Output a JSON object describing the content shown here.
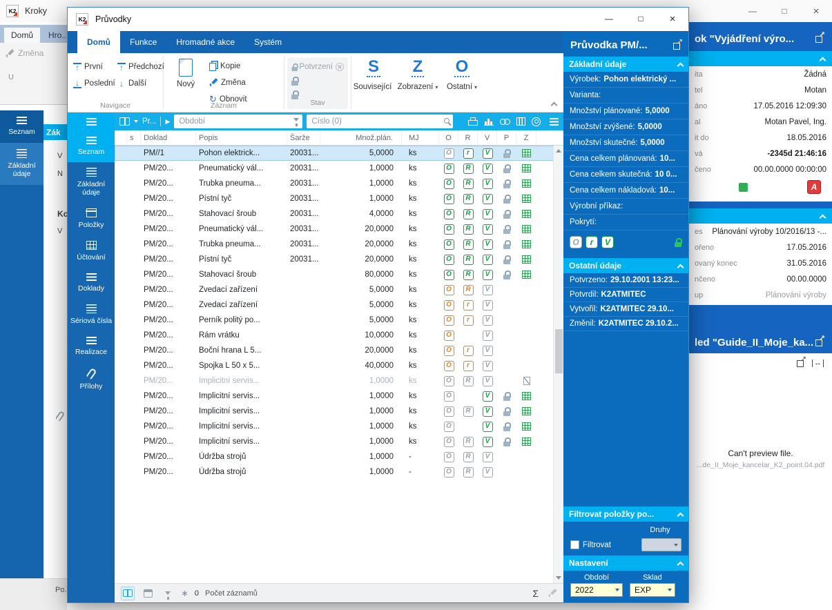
{
  "app": {
    "title": "Kroky",
    "logo": "K2",
    "window_controls": {
      "minimize": "—",
      "maximize": "□",
      "close": "×"
    }
  },
  "bg_left": {
    "tabs": [
      {
        "label": "Domů",
        "cls": "active"
      },
      {
        "label": "Hro...",
        "cls": ""
      }
    ],
    "change_label": "Změna",
    "fragment_u": "U",
    "sidebar": [
      {
        "label": "Seznam",
        "cls": "drk",
        "icon": "icon-lines"
      },
      {
        "label": "Základní údaje",
        "cls": "lit",
        "icon": "icon-lines2"
      }
    ],
    "strip": {
      "header": "Zák",
      "f1": "V",
      "f2": "N",
      "f3": "Ko",
      "f4": "V",
      "bottom": "Po..."
    }
  },
  "bg_right": {
    "panel1": {
      "title": "ok \"Vyjádření výro...",
      "rows": [
        {
          "label": "ita",
          "value": "Žádná",
          "vcls": ""
        },
        {
          "label": "tel",
          "value": "Motan",
          "vcls": ""
        },
        {
          "label": "áno",
          "value": "17.05.2016 12:09:30",
          "vcls": ""
        },
        {
          "label": "al",
          "value": "Motan Pavel, Ing.",
          "vcls": ""
        },
        {
          "label": "it do",
          "value": "18.05.2016",
          "vcls": ""
        },
        {
          "label": "vá",
          "value": "-2345d 21:46:16",
          "vcls": "bold"
        },
        {
          "label": "čeno",
          "value": "00.00.0000 00:00:00",
          "vcls": ""
        }
      ]
    },
    "panel2": {
      "rows": [
        {
          "label": "es",
          "value": "Plánování výroby 10/2016/13 -...",
          "vcls": ""
        },
        {
          "label": "ořeno",
          "value": "17.05.2016",
          "vcls": ""
        },
        {
          "label": "ovaný konec",
          "value": "31.05.2016",
          "vcls": ""
        },
        {
          "label": "nčeno",
          "value": "00.00.0000",
          "vcls": ""
        },
        {
          "label": "up",
          "value": "Plánování výroby",
          "vcls": "muted"
        }
      ]
    },
    "panel3": {
      "title": "led \"Guide_II_Moje_ka...",
      "error": "Can't preview file.",
      "file": "...de_II_Moje_kancelar_K2_point.04.pdf"
    }
  },
  "dialog": {
    "title": "Průvodky",
    "ribbon": {
      "tabs": [
        {
          "label": "Domů",
          "cls": "active"
        },
        {
          "label": "Funkce",
          "cls": ""
        },
        {
          "label": "Hromadné akce",
          "cls": ""
        },
        {
          "label": "Systém",
          "cls": ""
        }
      ],
      "navigace": {
        "first": "První",
        "last": "Poslední",
        "prev": "Předchozí",
        "next": "Další",
        "group": "Navigace"
      },
      "zaznam": {
        "new": "Nový",
        "copy": "Kopie",
        "change": "Změna",
        "refresh": "Obnovit",
        "group": "Záznam"
      },
      "stav": {
        "confirm": "Potvrzení",
        "group": "Stav"
      },
      "big": [
        {
          "letter": "S",
          "label": "Související",
          "arrow": ""
        },
        {
          "letter": "Z",
          "label": "Zobrazení",
          "arrow": "▾"
        },
        {
          "letter": "O",
          "label": "Ostatní",
          "arrow": "▾"
        }
      ]
    },
    "nav": [
      {
        "label": "Seznam",
        "icon": "icon-lines",
        "cls": "active"
      },
      {
        "label": "Základní údaje",
        "icon": "icon-lines2",
        "cls": ""
      },
      {
        "label": "Položky",
        "icon": "icon-boxp",
        "cls": ""
      },
      {
        "label": "Účtování",
        "icon": "icon-gridp",
        "cls": ""
      },
      {
        "label": "Doklady",
        "icon": "icon-lines",
        "cls": ""
      },
      {
        "label": "Sériová čísla",
        "icon": "icon-lines2",
        "cls": ""
      },
      {
        "label": "Realizace",
        "icon": "icon-lines",
        "cls": ""
      },
      {
        "label": "Přílohy",
        "icon": "icon-clip",
        "cls": ""
      }
    ],
    "toolbar": {
      "view": "Pr...",
      "period_placeholder": "Období",
      "number_placeholder": "Číslo (0)"
    },
    "table": {
      "headers": [
        "s",
        "Doklad",
        "Popis",
        "Šarže",
        "Množ.plán.",
        "MJ",
        "O",
        "R",
        "V",
        "P",
        "Z"
      ],
      "rows": [
        {
          "cls": "sel",
          "doklad": "PM//1",
          "popis": "Pohon elektrick...",
          "sarze": "20031...",
          "qty": "5,0000",
          "mj": "ks",
          "o_t": "O",
          "o_c": "gy",
          "r_t": "r",
          "r_c": "g",
          "v_t": "V",
          "v_c": "g",
          "p": "on",
          "z": "gridic"
        },
        {
          "cls": "",
          "doklad": "PM/20...",
          "popis": "Pneumatický vál...",
          "sarze": "20031...",
          "qty": "1,0000",
          "mj": "ks",
          "o_t": "O",
          "o_c": "g",
          "r_t": "R",
          "r_c": "g",
          "v_t": "V",
          "v_c": "g",
          "p": "on",
          "z": "gridic"
        },
        {
          "cls": "",
          "doklad": "PM/20...",
          "popis": "Trubka pneuma...",
          "sarze": "20031...",
          "qty": "1,0000",
          "mj": "ks",
          "o_t": "O",
          "o_c": "g",
          "r_t": "R",
          "r_c": "g",
          "v_t": "V",
          "v_c": "g",
          "p": "on",
          "z": "gridic"
        },
        {
          "cls": "",
          "doklad": "PM/20...",
          "popis": "Pístní tyč",
          "sarze": "20031...",
          "qty": "1,0000",
          "mj": "ks",
          "o_t": "O",
          "o_c": "g",
          "r_t": "R",
          "r_c": "g",
          "v_t": "V",
          "v_c": "g",
          "p": "on",
          "z": "gridic"
        },
        {
          "cls": "",
          "doklad": "PM/20...",
          "popis": "Stahovací šroub",
          "sarze": "20031...",
          "qty": "4,0000",
          "mj": "ks",
          "o_t": "O",
          "o_c": "g",
          "r_t": "R",
          "r_c": "g",
          "v_t": "V",
          "v_c": "g",
          "p": "on",
          "z": "gridic"
        },
        {
          "cls": "",
          "doklad": "PM/20...",
          "popis": "Pneumatický vál...",
          "sarze": "20031...",
          "qty": "20,0000",
          "mj": "ks",
          "o_t": "O",
          "o_c": "g",
          "r_t": "R",
          "r_c": "g",
          "v_t": "V",
          "v_c": "g",
          "p": "on",
          "z": "gridic"
        },
        {
          "cls": "",
          "doklad": "PM/20...",
          "popis": "Trubka pneuma...",
          "sarze": "20031...",
          "qty": "20,0000",
          "mj": "ks",
          "o_t": "O",
          "o_c": "g",
          "r_t": "R",
          "r_c": "g",
          "v_t": "V",
          "v_c": "g",
          "p": "on",
          "z": "gridic"
        },
        {
          "cls": "",
          "doklad": "PM/20...",
          "popis": "Pístní tyč",
          "sarze": "20031...",
          "qty": "20,0000",
          "mj": "ks",
          "o_t": "O",
          "o_c": "g",
          "r_t": "R",
          "r_c": "g",
          "v_t": "V",
          "v_c": "g",
          "p": "on",
          "z": "gridic"
        },
        {
          "cls": "",
          "doklad": "PM/20...",
          "popis": "Stahovací šroub",
          "sarze": "",
          "qty": "80,0000",
          "mj": "ks",
          "o_t": "O",
          "o_c": "g",
          "r_t": "R",
          "r_c": "g",
          "v_t": "V",
          "v_c": "g",
          "p": "on",
          "z": "gridic"
        },
        {
          "cls": "",
          "doklad": "PM/20...",
          "popis": "Zvedací zařízení",
          "sarze": "",
          "qty": "5,0000",
          "mj": "ks",
          "o_t": "O",
          "o_c": "og",
          "r_t": "R",
          "r_c": "og",
          "v_t": "V",
          "v_c": "gy",
          "p": "",
          "z": ""
        },
        {
          "cls": "",
          "doklad": "PM/20...",
          "popis": "Zvedací zařízení",
          "sarze": "",
          "qty": "5,0000",
          "mj": "ks",
          "o_t": "O",
          "o_c": "og",
          "r_t": "r",
          "r_c": "og",
          "v_t": "V",
          "v_c": "gy",
          "p": "",
          "z": ""
        },
        {
          "cls": "",
          "doklad": "PM/20...",
          "popis": "Perník politý po...",
          "sarze": "",
          "qty": "5,0000",
          "mj": "ks",
          "o_t": "O",
          "o_c": "og",
          "r_t": "r",
          "r_c": "og",
          "v_t": "V",
          "v_c": "gy",
          "p": "",
          "z": ""
        },
        {
          "cls": "",
          "doklad": "PM/20...",
          "popis": "Rám vrátku",
          "sarze": "",
          "qty": "10,0000",
          "mj": "ks",
          "o_t": "O",
          "o_c": "og",
          "r_t": "",
          "r_c": "",
          "v_t": "V",
          "v_c": "gy",
          "p": "",
          "z": ""
        },
        {
          "cls": "",
          "doklad": "PM/20...",
          "popis": "Boční hrana L 5...",
          "sarze": "",
          "qty": "20,0000",
          "mj": "ks",
          "o_t": "O",
          "o_c": "og",
          "r_t": "r",
          "r_c": "og",
          "v_t": "V",
          "v_c": "gy",
          "p": "",
          "z": ""
        },
        {
          "cls": "",
          "doklad": "PM/20...",
          "popis": "Spojka L 50 x 5...",
          "sarze": "",
          "qty": "40,0000",
          "mj": "ks",
          "o_t": "O",
          "o_c": "og",
          "r_t": "r",
          "r_c": "og",
          "v_t": "V",
          "v_c": "gy",
          "p": "",
          "z": ""
        },
        {
          "cls": "dim",
          "doklad": "PM/20...",
          "popis": "Implicitní servis...",
          "sarze": "",
          "qty": "1,0000",
          "mj": "ks",
          "o_t": "O",
          "o_c": "gy",
          "r_t": "R",
          "r_c": "gy",
          "v_t": "V",
          "v_c": "gy",
          "p": "",
          "z": "docx"
        },
        {
          "cls": "",
          "doklad": "PM/20...",
          "popis": "Implicitní servis...",
          "sarze": "",
          "qty": "1,0000",
          "mj": "ks",
          "o_t": "O",
          "o_c": "gy",
          "r_t": "",
          "r_c": "",
          "v_t": "V",
          "v_c": "g",
          "p": "on",
          "z": "gridic"
        },
        {
          "cls": "",
          "doklad": "PM/20...",
          "popis": "Implicitní servis...",
          "sarze": "",
          "qty": "1,0000",
          "mj": "ks",
          "o_t": "O",
          "o_c": "gy",
          "r_t": "R",
          "r_c": "gy",
          "v_t": "V",
          "v_c": "g",
          "p": "on",
          "z": "gridic"
        },
        {
          "cls": "",
          "doklad": "PM/20...",
          "popis": "Implicitní servis...",
          "sarze": "",
          "qty": "1,0000",
          "mj": "ks",
          "o_t": "O",
          "o_c": "gy",
          "r_t": "",
          "r_c": "",
          "v_t": "V",
          "v_c": "g",
          "p": "on",
          "z": "gridic"
        },
        {
          "cls": "",
          "doklad": "PM/20...",
          "popis": "Implicitní servis...",
          "sarze": "",
          "qty": "1,0000",
          "mj": "ks",
          "o_t": "O",
          "o_c": "gy",
          "r_t": "R",
          "r_c": "gy",
          "v_t": "V",
          "v_c": "g",
          "p": "on",
          "z": "gridic"
        },
        {
          "cls": "",
          "doklad": "PM/20...",
          "popis": "Údržba strojů",
          "sarze": "",
          "qty": "1,0000",
          "mj": "-",
          "o_t": "O",
          "o_c": "gy",
          "r_t": "R",
          "r_c": "gy",
          "v_t": "V",
          "v_c": "gy",
          "p": "",
          "z": ""
        },
        {
          "cls": "",
          "doklad": "PM/20...",
          "popis": "Údržba strojů",
          "sarze": "",
          "qty": "1,0000",
          "mj": "-",
          "o_t": "O",
          "o_c": "gy",
          "r_t": "R",
          "r_c": "gy",
          "v_t": "V",
          "v_c": "gy",
          "p": "",
          "z": ""
        }
      ]
    },
    "statusbar": {
      "zero": "0",
      "count_label": "Počet záznamů"
    },
    "panel": {
      "title": "Průvodka PM/...",
      "sec1": {
        "title": "Základní údaje",
        "fields": [
          {
            "label": "Výrobek:",
            "value": "Pohon elektrický ..."
          },
          {
            "label": "Varianta:",
            "value": ""
          },
          {
            "label": "Množství plánované:",
            "value": "5,0000"
          },
          {
            "label": "Množství zvýšené:",
            "value": "5,0000"
          },
          {
            "label": "Množství skutečné:",
            "value": "5,0000"
          },
          {
            "label": "Cena celkem plánovaná:",
            "value": "10..."
          },
          {
            "label": "Cena celkem skutečná:",
            "value": "10 0..."
          },
          {
            "label": "Cena celkem nákladová:",
            "value": "10..."
          },
          {
            "label": "Výrobní příkaz:",
            "value": ""
          },
          {
            "label": "Pokrytí:",
            "value": ""
          }
        ],
        "status_icons": [
          {
            "t": "O",
            "c": "gy"
          },
          {
            "t": "r",
            "c": "g"
          },
          {
            "t": "V",
            "c": "g"
          }
        ]
      },
      "sec2": {
        "title": "Ostatní údaje",
        "fields": [
          {
            "label": "Potvrzeno:",
            "value": "29.10.2001 13:23..."
          },
          {
            "label": "Potvrdil:",
            "value": "K2ATMITEC"
          },
          {
            "label": "Vytvořil:",
            "value": "K2ATMITEC 29.10..."
          },
          {
            "label": "Změnil:",
            "value": "K2ATMITEC 29.10.2..."
          }
        ]
      },
      "sec3": {
        "title": "Filtrovat položky po...",
        "druhy": "Druhy",
        "checkbox": "Filtrovat"
      },
      "sec4": {
        "title": "Nastavení",
        "period_label": "Období",
        "period_value": "2022",
        "sklad_label": "Sklad",
        "sklad_value": "EXP"
      }
    }
  },
  "colors": {
    "accent_blue": "#1565c0",
    "cyan": "#00b0f0",
    "green": "#13a241",
    "orange": "#e8821f",
    "gray": "#97a3ad"
  }
}
